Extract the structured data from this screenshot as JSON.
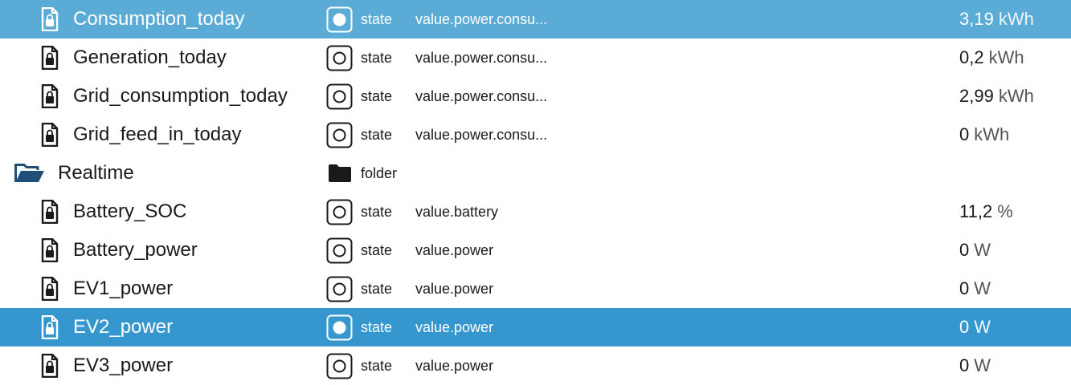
{
  "colors": {
    "hover_row": "#5aabd6",
    "selected_row": "#3697cf",
    "text": "#1a1a1a",
    "folder_icon": "#1f4e79"
  },
  "rows": [
    {
      "name": "Consumption_today",
      "icon": "locked-file-icon",
      "type": "state",
      "type_icon": "state-icon",
      "role": "value.power.consu...",
      "value": "3,19",
      "unit": "kWh",
      "state": "hover"
    },
    {
      "name": "Generation_today",
      "icon": "locked-file-icon",
      "type": "state",
      "type_icon": "state-icon",
      "role": "value.power.consu...",
      "value": "0,2",
      "unit": "kWh",
      "state": "normal"
    },
    {
      "name": "Grid_consumption_today",
      "icon": "locked-file-icon",
      "type": "state",
      "type_icon": "state-icon",
      "role": "value.power.consu...",
      "value": "2,99",
      "unit": "kWh",
      "state": "normal"
    },
    {
      "name": "Grid_feed_in_today",
      "icon": "locked-file-icon",
      "type": "state",
      "type_icon": "state-icon",
      "role": "value.power.consu...",
      "value": "0",
      "unit": "kWh",
      "state": "normal"
    },
    {
      "name": "Realtime",
      "icon": "open-folder-icon",
      "type": "folder",
      "type_icon": "folder-icon",
      "role": "",
      "value": "",
      "unit": "",
      "state": "normal"
    },
    {
      "name": "Battery_SOC",
      "icon": "locked-file-icon",
      "type": "state",
      "type_icon": "state-icon",
      "role": "value.battery",
      "value": "11,2",
      "unit": "%",
      "state": "normal"
    },
    {
      "name": "Battery_power",
      "icon": "locked-file-icon",
      "type": "state",
      "type_icon": "state-icon",
      "role": "value.power",
      "value": "0",
      "unit": "W",
      "state": "normal"
    },
    {
      "name": "EV1_power",
      "icon": "locked-file-icon",
      "type": "state",
      "type_icon": "state-icon",
      "role": "value.power",
      "value": "0",
      "unit": "W",
      "state": "normal"
    },
    {
      "name": "EV2_power",
      "icon": "locked-file-icon",
      "type": "state",
      "type_icon": "state-icon",
      "role": "value.power",
      "value": "0",
      "unit": "W",
      "state": "selected"
    },
    {
      "name": "EV3_power",
      "icon": "locked-file-icon",
      "type": "state",
      "type_icon": "state-icon",
      "role": "value.power",
      "value": "0",
      "unit": "W",
      "state": "normal"
    }
  ]
}
